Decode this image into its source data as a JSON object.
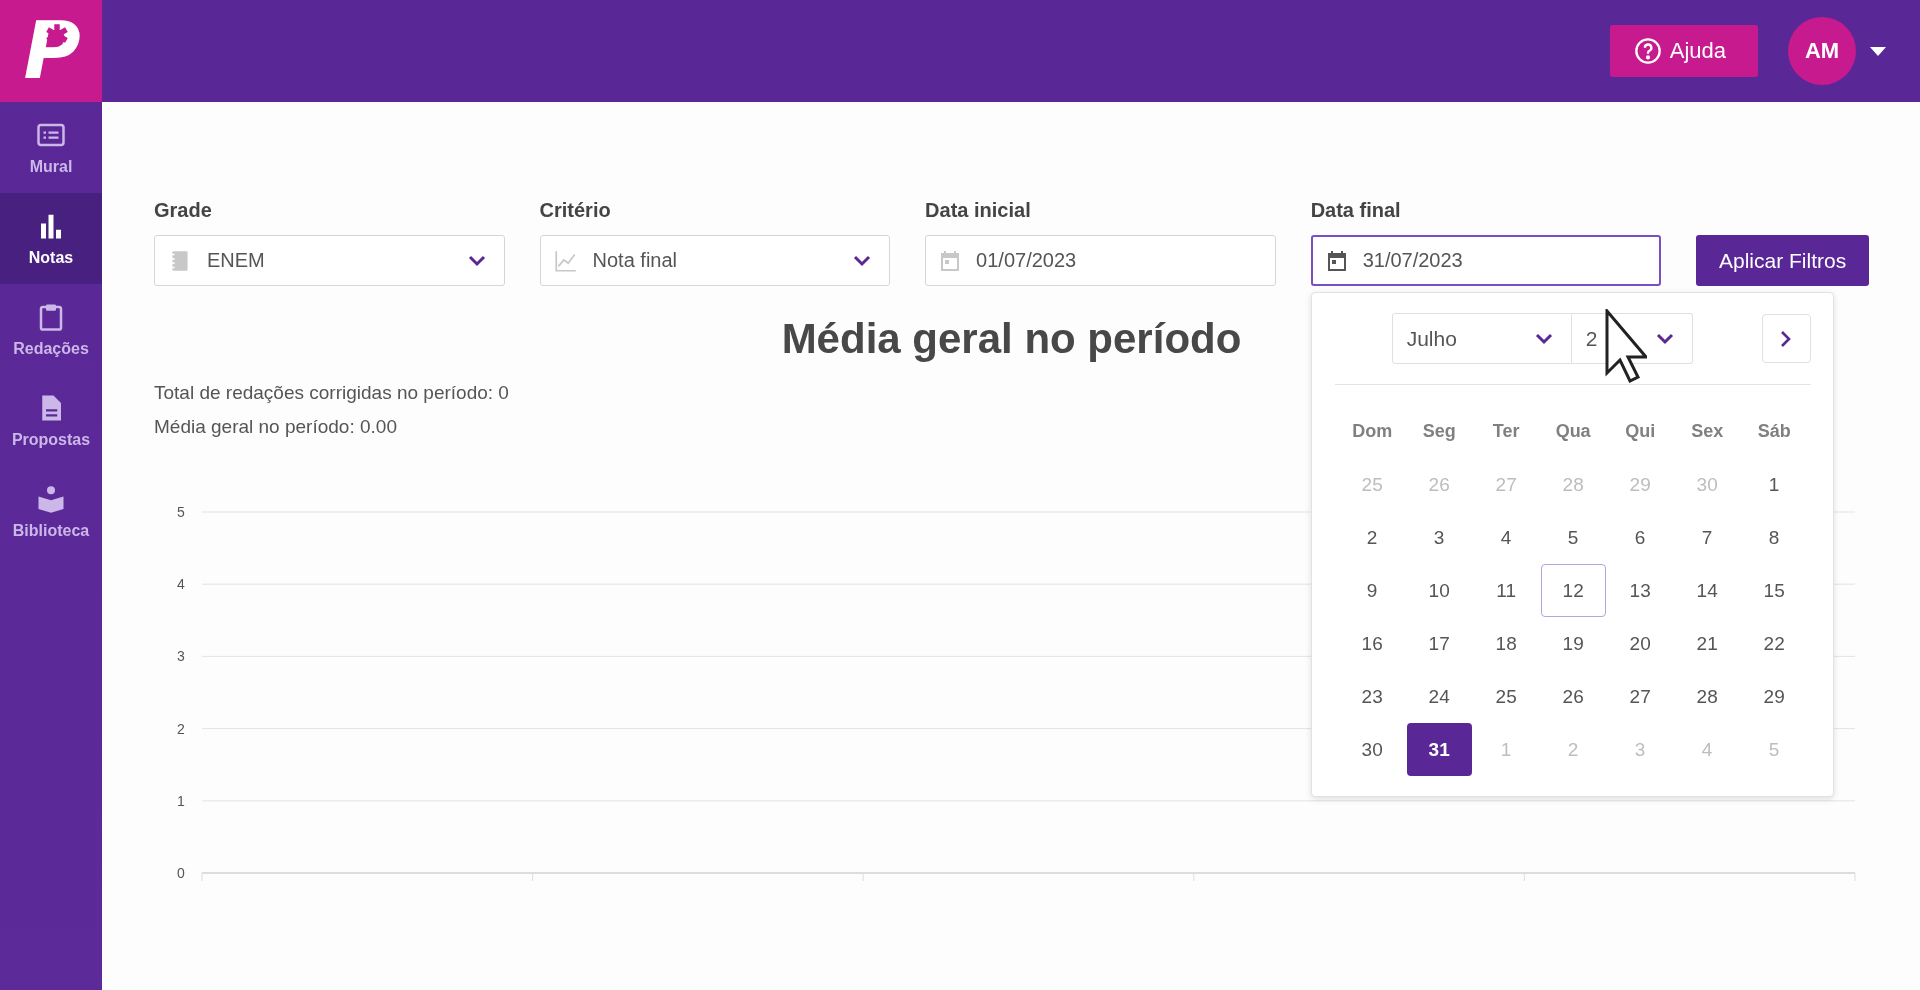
{
  "logo": "P",
  "header": {
    "help_button": "Ajuda",
    "avatar": "AM"
  },
  "sidebar": {
    "items": [
      {
        "label": "Mural",
        "selected": false
      },
      {
        "label": "Notas",
        "selected": true
      },
      {
        "label": "Redações",
        "selected": false
      },
      {
        "label": "Propostas",
        "selected": false
      },
      {
        "label": "Biblioteca",
        "selected": false
      }
    ]
  },
  "filters": [
    {
      "kind": "select",
      "label": "Grade",
      "value": "ENEM",
      "focused": false
    },
    {
      "kind": "select",
      "label": "Critério",
      "value": "Nota final",
      "focused": false
    },
    {
      "kind": "date",
      "label": "Data inicial",
      "value": "01/07/2023",
      "focused": false
    },
    {
      "kind": "date",
      "label": "Data final",
      "value": "31/07/2023",
      "focused": true
    }
  ],
  "apply_button": "Aplicar Filtros",
  "date_picker": {
    "month": "Julho",
    "year": "2",
    "weekdays": [
      "Dom",
      "Seg",
      "Ter",
      "Qua",
      "Qui",
      "Sex",
      "Sáb"
    ],
    "days": [
      {
        "label": "25",
        "muted": true,
        "selected": false,
        "today": false
      },
      {
        "label": "26",
        "muted": true,
        "selected": false,
        "today": false
      },
      {
        "label": "27",
        "muted": true,
        "selected": false,
        "today": false
      },
      {
        "label": "28",
        "muted": true,
        "selected": false,
        "today": false
      },
      {
        "label": "29",
        "muted": true,
        "selected": false,
        "today": false
      },
      {
        "label": "30",
        "muted": true,
        "selected": false,
        "today": false
      },
      {
        "label": "1",
        "muted": false,
        "selected": false,
        "today": false
      },
      {
        "label": "2",
        "muted": false,
        "selected": false,
        "today": false
      },
      {
        "label": "3",
        "muted": false,
        "selected": false,
        "today": false
      },
      {
        "label": "4",
        "muted": false,
        "selected": false,
        "today": false
      },
      {
        "label": "5",
        "muted": false,
        "selected": false,
        "today": false
      },
      {
        "label": "6",
        "muted": false,
        "selected": false,
        "today": false
      },
      {
        "label": "7",
        "muted": false,
        "selected": false,
        "today": false
      },
      {
        "label": "8",
        "muted": false,
        "selected": false,
        "today": false
      },
      {
        "label": "9",
        "muted": false,
        "selected": false,
        "today": false
      },
      {
        "label": "10",
        "muted": false,
        "selected": false,
        "today": false
      },
      {
        "label": "11",
        "muted": false,
        "selected": false,
        "today": false
      },
      {
        "label": "12",
        "muted": false,
        "selected": false,
        "today": true
      },
      {
        "label": "13",
        "muted": false,
        "selected": false,
        "today": false
      },
      {
        "label": "14",
        "muted": false,
        "selected": false,
        "today": false
      },
      {
        "label": "15",
        "muted": false,
        "selected": false,
        "today": false
      },
      {
        "label": "16",
        "muted": false,
        "selected": false,
        "today": false
      },
      {
        "label": "17",
        "muted": false,
        "selected": false,
        "today": false
      },
      {
        "label": "18",
        "muted": false,
        "selected": false,
        "today": false
      },
      {
        "label": "19",
        "muted": false,
        "selected": false,
        "today": false
      },
      {
        "label": "20",
        "muted": false,
        "selected": false,
        "today": false
      },
      {
        "label": "21",
        "muted": false,
        "selected": false,
        "today": false
      },
      {
        "label": "22",
        "muted": false,
        "selected": false,
        "today": false
      },
      {
        "label": "23",
        "muted": false,
        "selected": false,
        "today": false
      },
      {
        "label": "24",
        "muted": false,
        "selected": false,
        "today": false
      },
      {
        "label": "25",
        "muted": false,
        "selected": false,
        "today": false
      },
      {
        "label": "26",
        "muted": false,
        "selected": false,
        "today": false
      },
      {
        "label": "27",
        "muted": false,
        "selected": false,
        "today": false
      },
      {
        "label": "28",
        "muted": false,
        "selected": false,
        "today": false
      },
      {
        "label": "29",
        "muted": false,
        "selected": false,
        "today": false
      },
      {
        "label": "30",
        "muted": false,
        "selected": false,
        "today": false
      },
      {
        "label": "31",
        "muted": false,
        "selected": true,
        "today": false
      },
      {
        "label": "1",
        "muted": true,
        "selected": false,
        "today": false
      },
      {
        "label": "2",
        "muted": true,
        "selected": false,
        "today": false
      },
      {
        "label": "3",
        "muted": true,
        "selected": false,
        "today": false
      },
      {
        "label": "4",
        "muted": true,
        "selected": false,
        "today": false
      },
      {
        "label": "5",
        "muted": true,
        "selected": false,
        "today": false
      }
    ]
  },
  "title": "Média geral no período",
  "stats": [
    "Total de redações corrigidas no período: 0",
    "Média geral no período: 0.00"
  ],
  "chart": {
    "y_ticks": [
      "5",
      "4",
      "3",
      "2",
      "1",
      "0"
    ]
  }
}
